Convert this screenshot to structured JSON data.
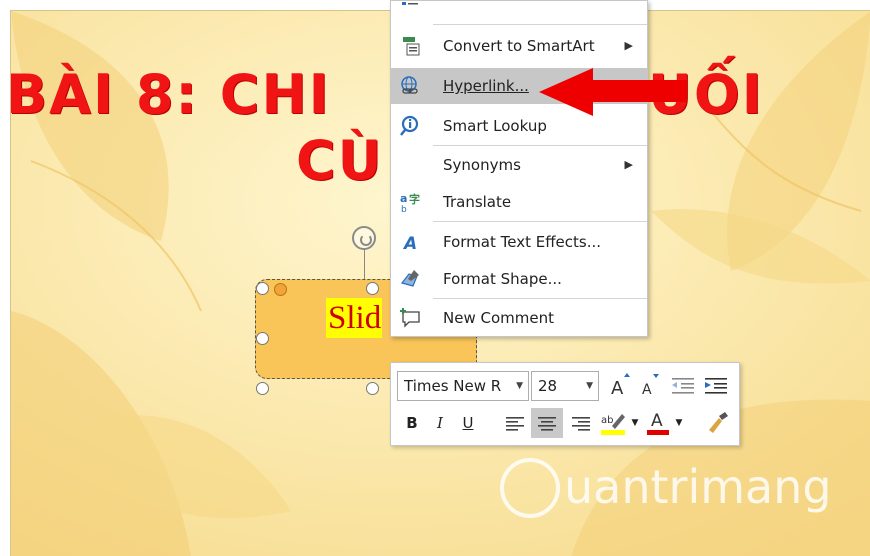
{
  "slide": {
    "title_line1_left": "BÀI 8: CHI",
    "title_line1_right": "UỐI",
    "title_line2": "CÙ",
    "shape_text": "Slide"
  },
  "context_menu": {
    "items": [
      {
        "label": "Convert to SmartArt",
        "icon": "smartart-icon",
        "submenu": true
      },
      {
        "label": "Hyperlink...",
        "icon": "hyperlink-icon",
        "submenu": false,
        "highlighted": true
      },
      {
        "label": "Smart Lookup",
        "icon": "smart-lookup-icon",
        "submenu": false
      },
      {
        "label": "Synonyms",
        "icon": "",
        "submenu": true
      },
      {
        "label": "Translate",
        "icon": "translate-icon",
        "submenu": false
      },
      {
        "label": "Format Text Effects...",
        "icon": "text-effects-icon",
        "submenu": false
      },
      {
        "label": "Format Shape...",
        "icon": "format-shape-icon",
        "submenu": false
      },
      {
        "label": "New Comment",
        "icon": "new-comment-icon",
        "submenu": false
      }
    ]
  },
  "mini_toolbar": {
    "font_name": "Times New R",
    "font_size": "28",
    "bold": "B",
    "italic": "I",
    "underline": "U",
    "font_color_letter": "A",
    "highlight_color": "#ffff00",
    "font_color": "#e00000"
  },
  "watermark": {
    "text": "uantrimang"
  },
  "colors": {
    "accent_title": "#f01414",
    "menu_highlight": "#c7c7c7",
    "arrow": "#ee0000"
  }
}
